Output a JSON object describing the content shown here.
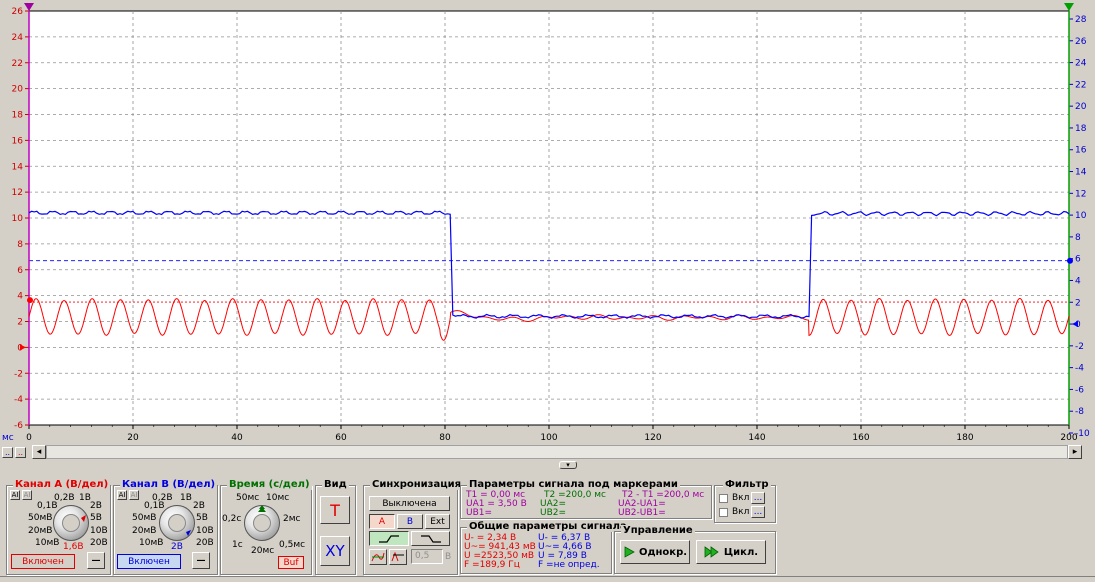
{
  "scope": {
    "y_left_ticks": [
      "26",
      "24",
      "22",
      "20",
      "18",
      "16",
      "14",
      "12",
      "10",
      "8",
      "6",
      "4",
      "2",
      "0",
      "-2",
      "-4",
      "-6"
    ],
    "y_right_ticks": [
      "28",
      "26",
      "24",
      "22",
      "20",
      "18",
      "16",
      "14",
      "12",
      "10",
      "8",
      "6",
      "4",
      "2",
      "0",
      "-2",
      "-4",
      "-6",
      "-8",
      "-10"
    ],
    "x_ticks": [
      "0",
      "20",
      "40",
      "60",
      "80",
      "100",
      "120",
      "140",
      "160",
      "180",
      "200"
    ],
    "x_unit": "мс",
    "colors": {
      "channel_a": "#ff0000",
      "channel_b": "#0000ff",
      "grid": "#909090",
      "background": "#ffffff"
    }
  },
  "chart_data": {
    "type": "line",
    "x_range": [
      0,
      200
    ],
    "y_left_range": [
      -6,
      26
    ],
    "y_right_range": [
      -10,
      28
    ],
    "series": [
      {
        "name": "Канал A",
        "color": "#ff0000",
        "axis": "left",
        "description_points": "sine ~18 periods, 1.0 to 3.7",
        "x": [
          0,
          80,
          81,
          150,
          151,
          200
        ],
        "y": [
          2.3,
          2.3,
          2.4,
          2.4,
          2.3,
          2.3
        ]
      },
      {
        "name": "Канал B",
        "color": "#0000ff",
        "axis": "left",
        "x": [
          0,
          81,
          81.5,
          150,
          150.5,
          200
        ],
        "y": [
          10.4,
          10.4,
          2.5,
          2.5,
          10.3,
          10.4
        ]
      }
    ],
    "markers": {
      "red_dotted": 3.5,
      "blue_dashed": 6.7,
      "left_mark_red": 0.0
    }
  },
  "panel": {
    "channel_a": {
      "title": "Канал А (В/дел)",
      "labels": [
        "0,1В",
        "0,2В",
        "1В",
        "2В",
        "5В",
        "10В",
        "20В",
        "50мВ",
        "20мВ",
        "10мВ"
      ],
      "value": "1,6В",
      "button": "Включен",
      "minus": "—"
    },
    "channel_b": {
      "title": "Канал В (В/дел)",
      "labels": [
        "0,1В",
        "0,2В",
        "1В",
        "2В",
        "5В",
        "10В",
        "20В",
        "50мВ",
        "20мВ",
        "10мВ"
      ],
      "value": "2В",
      "button": "Включен",
      "minus": "—"
    },
    "time": {
      "title": "Время (с/дел)",
      "labels": [
        "50мс",
        "10мс",
        "2мс",
        "0,5мс",
        "20мс",
        "1с",
        "0,2с"
      ],
      "button": "Buf"
    },
    "view": {
      "title": "Вид",
      "t": "T",
      "xy": "XY"
    },
    "sync": {
      "title": "Синхронизация",
      "state": "Выключена",
      "a": "A",
      "b": "B",
      "ext": "Ext",
      "level": "0,5",
      "unit": "В"
    },
    "markers_params": {
      "title": "Параметры сигнала под маркерами",
      "t1": "T1 = 0,00 мс",
      "ua1": "UA1 = 3,50 В",
      "ub1": "UB1=",
      "t2": "T2 =200,0 мс",
      "ua2": "UA2=",
      "ub2": "UB2=",
      "dt": "T2 - T1 =200,0 мс",
      "dua": "UA2-UA1=",
      "dub": "UB2-UB1="
    },
    "general_params": {
      "title": "Общие параметры сигнала",
      "a1": "U- = 2,34 В",
      "a2": "U~= 941,43 мВ",
      "a3": "U =2523,50 мВ",
      "a4": "F =189,9 Гц",
      "b1": "U- = 6,37 В",
      "b2": "U~= 4,66 В",
      "b3": "U = 7,89 В",
      "b4": "F =не опред."
    },
    "filter": {
      "title": "Фильтр",
      "opt": "Вкл",
      "dots": "..."
    },
    "control": {
      "title": "Управление",
      "single": "Однокр.",
      "cycle": "Цикл."
    }
  }
}
